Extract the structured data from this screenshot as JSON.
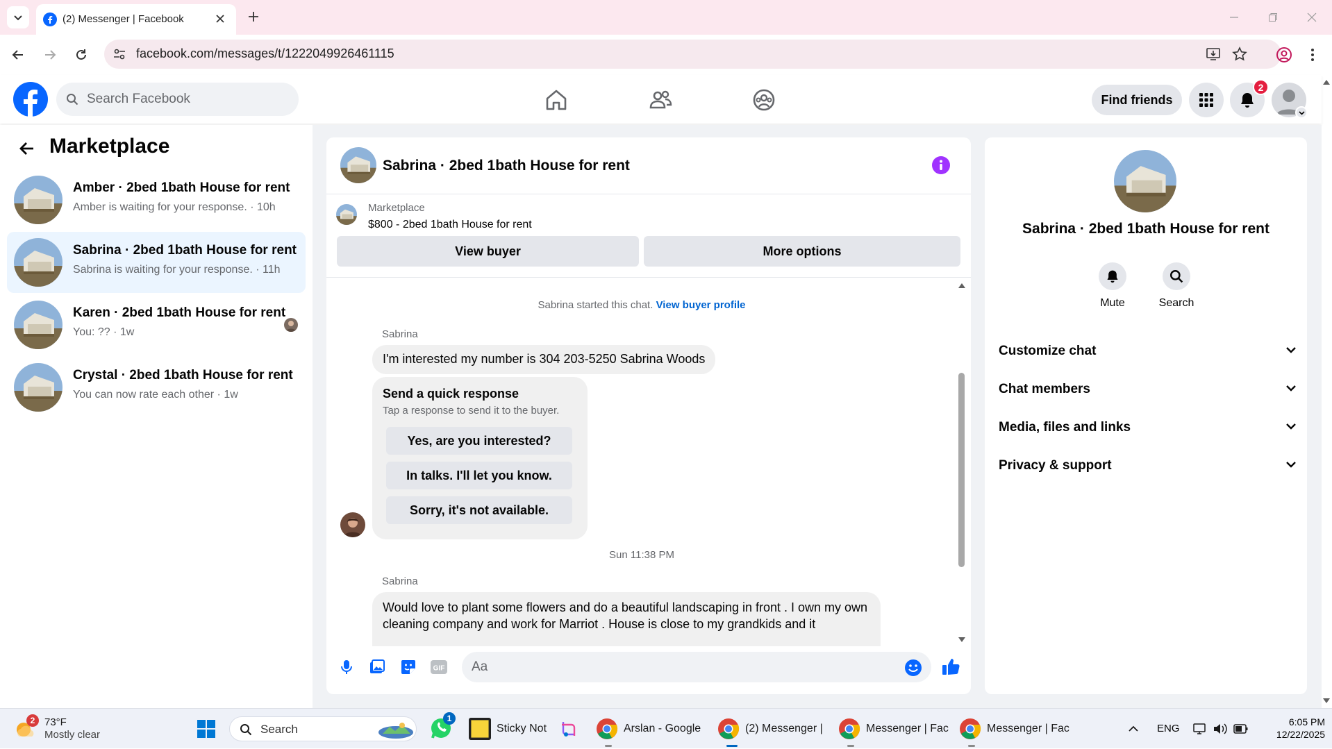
{
  "browser": {
    "tab_title": "(2) Messenger | Facebook",
    "url": "facebook.com/messages/t/1222049926461115"
  },
  "fb": {
    "search_placeholder": "Search Facebook",
    "find_friends": "Find friends",
    "notif_count": "2",
    "brand_color": "#0866ff"
  },
  "sidebar": {
    "title": "Marketplace",
    "conversations": [
      {
        "title": "Amber · 2bed 1bath House for rent",
        "subtitle": "Amber is waiting for your response. · 10h"
      },
      {
        "title": "Sabrina · 2bed 1bath House for rent",
        "subtitle": "Sabrina is waiting for your response. · 11h"
      },
      {
        "title": "Karen · 2bed 1bath House for rent",
        "subtitle": "You: ?? · 1w"
      },
      {
        "title": "Crystal · 2bed 1bath House for rent",
        "subtitle": "You can now rate each other · 1w"
      }
    ]
  },
  "chat": {
    "title": "Sabrina · 2bed 1bath House for rent",
    "listing_source": "Marketplace",
    "listing_text": "$800 - 2bed 1bath House for rent",
    "view_buyer": "View buyer",
    "more_options": "More options",
    "started_text": "Sabrina started this chat.",
    "view_buyer_profile": "View buyer profile",
    "sender1": "Sabrina",
    "message1": "I'm interested my number is 304 203-5250 Sabrina Woods",
    "quick_title": "Send a quick response",
    "quick_sub": "Tap a response to send it to the buyer.",
    "quick_replies": [
      "Yes, are you interested?",
      "In talks. I'll let you know.",
      "Sorry, it's not available."
    ],
    "timestamp": "Sun 11:38 PM",
    "sender2": "Sabrina",
    "message2": "Would love to plant some flowers and do a beautiful landscaping in front . I own my own cleaning company and work for Marriot . House is close to my grandkids and it",
    "composer_placeholder": "Aa"
  },
  "info": {
    "name": "Sabrina · 2bed 1bath House for rent",
    "mute": "Mute",
    "search": "Search",
    "sections": [
      "Customize chat",
      "Chat members",
      "Media, files and links",
      "Privacy & support"
    ]
  },
  "taskbar": {
    "weather_temp": "73°F",
    "weather_desc": "Mostly clear",
    "weather_badge": "2",
    "search": "Search",
    "whatsapp_badge": "1",
    "apps": [
      "Sticky Not",
      "Arslan - Google",
      "(2) Messenger |",
      "Messenger | Fac",
      "Messenger | Fac"
    ],
    "lang": "ENG",
    "time": "6:05 PM",
    "date": "12/22/2025"
  }
}
